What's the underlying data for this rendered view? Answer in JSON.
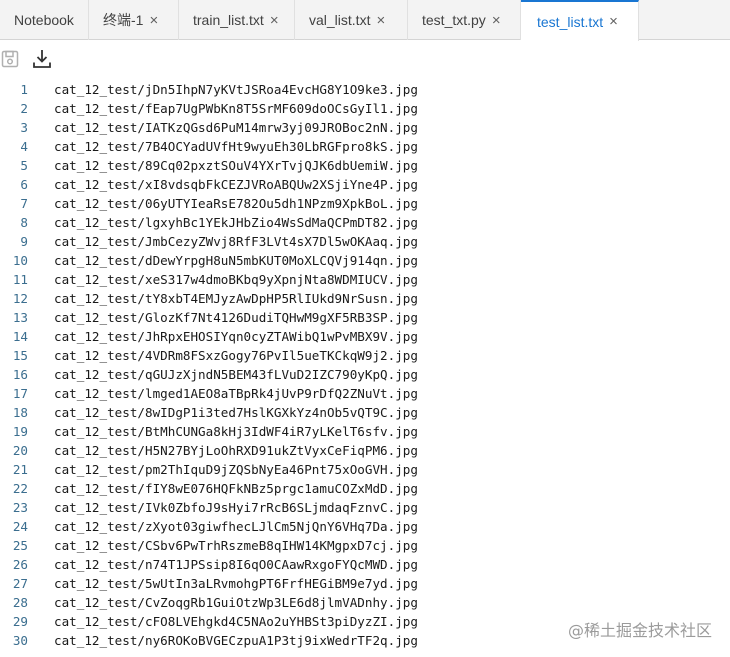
{
  "tabs": [
    {
      "label": "Notebook",
      "closable": false,
      "active": false
    },
    {
      "label": "终端-1",
      "closable": true,
      "active": false
    },
    {
      "label": "train_list.txt",
      "closable": true,
      "active": false
    },
    {
      "label": "val_list.txt",
      "closable": true,
      "active": false
    },
    {
      "label": "test_txt.py",
      "closable": true,
      "active": false
    },
    {
      "label": "test_list.txt",
      "closable": true,
      "active": true
    }
  ],
  "close_glyph": "×",
  "toolbar": {
    "save_icon": "save-icon",
    "download_icon": "download-icon"
  },
  "editor": {
    "lines": [
      {
        "n": "1",
        "text": "cat_12_test/jDn5IhpN7yKVtJSRoa4EvcHG8Y1O9ke3.jpg"
      },
      {
        "n": "2",
        "text": "cat_12_test/fEap7UgPWbKn8T5SrMF609doOCsGyIl1.jpg"
      },
      {
        "n": "3",
        "text": "cat_12_test/IATKzQGsd6PuM14mrw3yj09JROBoc2nN.jpg"
      },
      {
        "n": "4",
        "text": "cat_12_test/7B4OCYadUVfHt9wyuEh30LbRGFpro8kS.jpg"
      },
      {
        "n": "5",
        "text": "cat_12_test/89Cq02pxztSOuV4YXrTvjQJK6dbUemiW.jpg"
      },
      {
        "n": "6",
        "text": "cat_12_test/xI8vdsqbFkCEZJVRoABQUw2XSjiYne4P.jpg"
      },
      {
        "n": "7",
        "text": "cat_12_test/06yUTYIeaRsE782Ou5dh1NPzm9XpkBoL.jpg"
      },
      {
        "n": "8",
        "text": "cat_12_test/lgxyhBc1YEkJHbZio4WsSdMaQCPmDT82.jpg"
      },
      {
        "n": "9",
        "text": "cat_12_test/JmbCezyZWvj8RfF3LVt4sX7Dl5wOKAaq.jpg"
      },
      {
        "n": "10",
        "text": "cat_12_test/dDewYrpgH8uN5mbKUT0MoXLCQVj914qn.jpg"
      },
      {
        "n": "11",
        "text": "cat_12_test/xeS317w4dmoBKbq9yXpnjNta8WDMIUCV.jpg"
      },
      {
        "n": "12",
        "text": "cat_12_test/tY8xbT4EMJyzAwDpHP5RlIUkd9NrSusn.jpg"
      },
      {
        "n": "13",
        "text": "cat_12_test/GlozKf7Nt4126DudiTQHwM9gXF5RB3SP.jpg"
      },
      {
        "n": "14",
        "text": "cat_12_test/JhRpxEHOSIYqn0cyZTAWibQ1wPvMBX9V.jpg"
      },
      {
        "n": "15",
        "text": "cat_12_test/4VDRm8FSxzGogy76PvIl5ueTKCkqW9j2.jpg"
      },
      {
        "n": "16",
        "text": "cat_12_test/qGUJzXjndN5BEM43fLVuD2IZC790yKpQ.jpg"
      },
      {
        "n": "17",
        "text": "cat_12_test/lmged1AEO8aTBpRk4jUvP9rDfQ2ZNuVt.jpg"
      },
      {
        "n": "18",
        "text": "cat_12_test/8wIDgP1i3ted7HslKGXkYz4nOb5vQT9C.jpg"
      },
      {
        "n": "19",
        "text": "cat_12_test/BtMhCUNGa8kHj3IdWF4iR7yLKelT6sfv.jpg"
      },
      {
        "n": "20",
        "text": "cat_12_test/H5N27BYjLoOhRXD91ukZtVyxCeFiqPM6.jpg"
      },
      {
        "n": "21",
        "text": "cat_12_test/pm2ThIquD9jZQSbNyEa46Pnt75xOoGVH.jpg"
      },
      {
        "n": "22",
        "text": "cat_12_test/fIY8wE076HQFkNBz5prgc1amuCOZxMdD.jpg"
      },
      {
        "n": "23",
        "text": "cat_12_test/IVk0ZbfoJ9sHyi7rRcB6SLjmdaqFznvC.jpg"
      },
      {
        "n": "24",
        "text": "cat_12_test/zXyot03giwfhecLJlCm5NjQnY6VHq7Da.jpg"
      },
      {
        "n": "25",
        "text": "cat_12_test/CSbv6PwTrhRszmeB8qIHW14KMgpxD7cj.jpg"
      },
      {
        "n": "26",
        "text": "cat_12_test/n74T1JPSsip8I6qO0CAawRxgoFYQcMWD.jpg"
      },
      {
        "n": "27",
        "text": "cat_12_test/5wUtIn3aLRvmohgPT6FrfHEGiBM9e7yd.jpg"
      },
      {
        "n": "28",
        "text": "cat_12_test/CvZoqgRb1GuiOtzWp3LE6d8jlmVADnhy.jpg"
      },
      {
        "n": "29",
        "text": "cat_12_test/cFO8LVEhgkd4C5NAo2uYHBSt3piDyzZI.jpg"
      },
      {
        "n": "30",
        "text": "cat_12_test/ny6ROKoBVGECzpuA1P3tj9ixWedrTF2q.jpg"
      }
    ]
  },
  "watermark": "@稀土掘金技术社区"
}
